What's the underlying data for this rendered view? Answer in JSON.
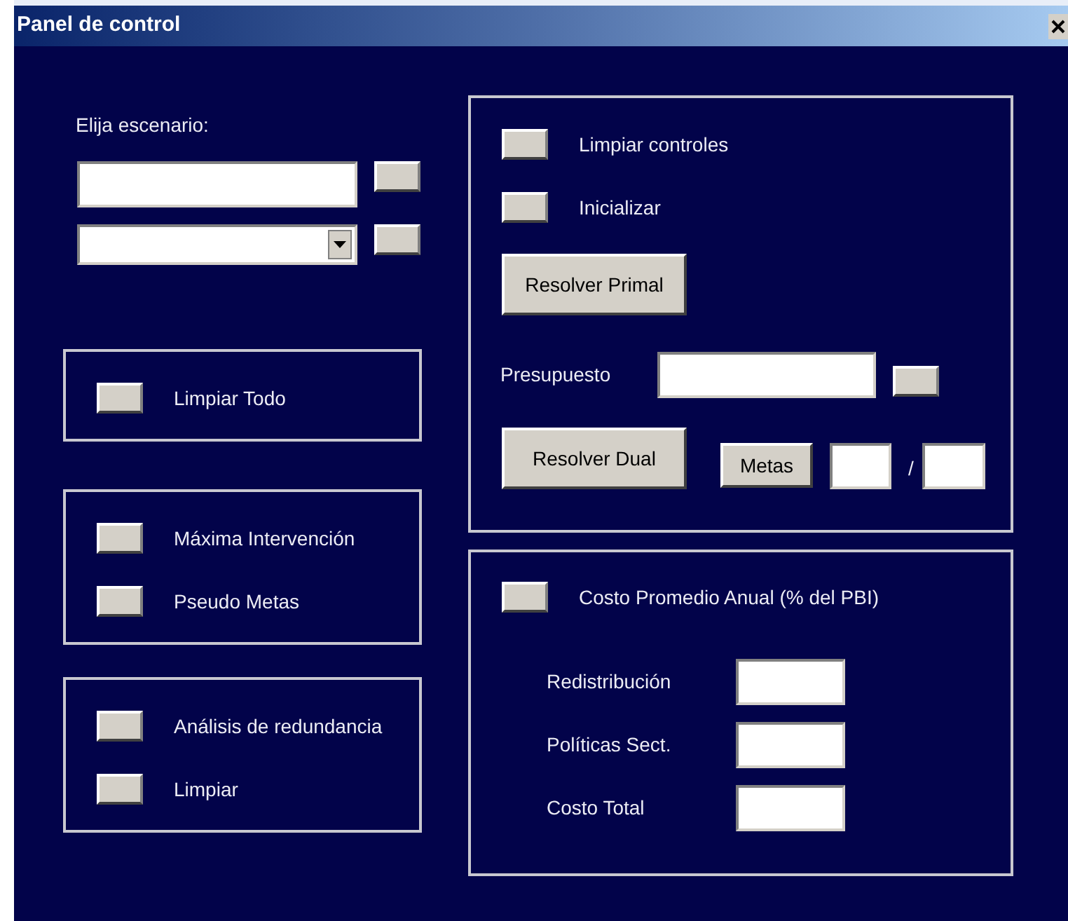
{
  "window": {
    "title": "Panel de control"
  },
  "scenario": {
    "label": "Elija escenario:"
  },
  "left_groups": [
    {
      "items": [
        {
          "label": "Limpiar Todo"
        }
      ]
    },
    {
      "items": [
        {
          "label": "Máxima Intervención"
        },
        {
          "label": "Pseudo Metas"
        }
      ]
    },
    {
      "items": [
        {
          "label": "Análisis de redundancia"
        },
        {
          "label": "Limpiar"
        }
      ]
    }
  ],
  "solver": {
    "items": [
      {
        "label": "Limpiar controles"
      },
      {
        "label": "Inicializar"
      }
    ],
    "primal_button": "Resolver Primal",
    "budget_label": "Presupuesto",
    "dual_button": "Resolver Dual",
    "goals_button": "Metas",
    "separator": "/"
  },
  "costs": {
    "toggle_label": "Costo Promedio Anual (% del PBI)",
    "rows": [
      {
        "label": "Redistribución"
      },
      {
        "label": "Políticas Sect."
      },
      {
        "label": "Costo Total"
      }
    ]
  }
}
